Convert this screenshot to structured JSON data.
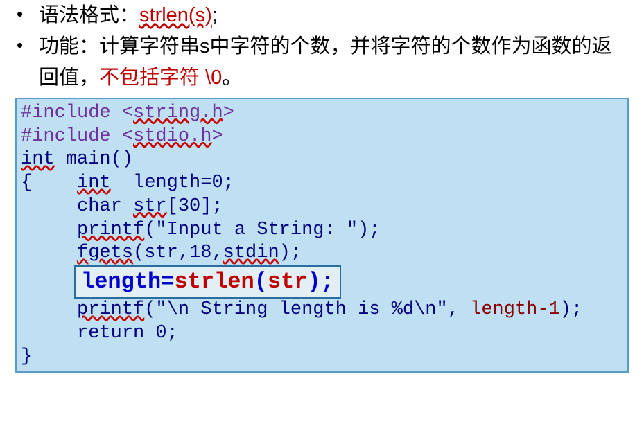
{
  "bullets": {
    "b1": {
      "label_prefix": "语法格式：",
      "syntax": "strlen(s)",
      "suffix": ";"
    },
    "b2": {
      "label_prefix": "功能：计算字符串s中字符的个数，并将字符的个数作为函数的返回值，",
      "red_part": "不包括字符 \\0",
      "suffix": "。"
    }
  },
  "code": {
    "line1_pre": "#include <",
    "line1_lib": "string.h",
    "line1_post": ">",
    "line2_pre": "#include <",
    "line2_lib": "stdio.h",
    "line2_post": ">",
    "line3_int": "int",
    "line3_rest": " main()",
    "line4": "{    ",
    "line4_int": "int",
    "line4_rest": "  length=0;",
    "line5_pre": "     char ",
    "line5_str": "str",
    "line5_post": "[30];",
    "line6_pre": "     ",
    "line6_printf": "printf",
    "line6_post": "(\"Input a String: \");",
    "line7_pre": "     ",
    "line7_fgets": "fgets",
    "line7_mid": "(str,18,",
    "line7_stdin": "stdin",
    "line7_post": ");",
    "hl_length": "length=",
    "hl_strlen": "strlen",
    "hl_open": "(",
    "hl_str": "str",
    "hl_close": ")",
    "hl_semi": ";",
    "line9_pre": "     ",
    "line9_printf": "printf",
    "line9_mid": "(\"\\n String length is %d\\n\", ",
    "line9_len": "length-1",
    "line9_post": ");",
    "line10": "     return 0;",
    "line11": "}"
  }
}
